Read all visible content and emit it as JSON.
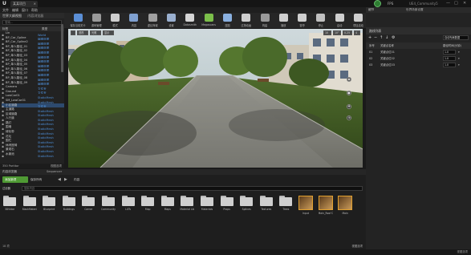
{
  "window": {
    "logo": "U",
    "tab_title": "某某项目",
    "fps_label": "FPS",
    "project_name": "UE4_Community5",
    "controls": [
      "—",
      "□",
      "✕"
    ]
  },
  "menu": [
    "文件",
    "编辑",
    "窗口",
    "帮助"
  ],
  "outliner": {
    "tabs": [
      "世界大纲视图",
      "内容浏览器"
    ],
    "search_placeholder": "搜索...",
    "col_label": "标签",
    "col_type": "类型",
    "rows": [
      {
        "label": "Lin",
        "type": "World",
        "sel": false
      },
      {
        "label": "BP_Car_Spline",
        "type": "编辑蓝图",
        "sel": false
      },
      {
        "label": "BP_Car_Spline2",
        "type": "编辑蓝图",
        "sel": false
      },
      {
        "label": "BP_单人路径_01",
        "type": "编辑蓝图",
        "sel": false
      },
      {
        "label": "BP_单人路径_02",
        "type": "编辑蓝图",
        "sel": false
      },
      {
        "label": "BP_单人路径_03",
        "type": "编辑蓝图",
        "sel": false
      },
      {
        "label": "BP_单人路径_04",
        "type": "编辑蓝图",
        "sel": false
      },
      {
        "label": "BP_单人路径_05",
        "type": "编辑蓝图",
        "sel": false
      },
      {
        "label": "BP_单人路径_06",
        "type": "编辑蓝图",
        "sel": false
      },
      {
        "label": "BP_单人路径_07",
        "type": "编辑蓝图",
        "sel": false
      },
      {
        "label": "BP_单人路径_08",
        "type": "编辑蓝图",
        "sel": false
      },
      {
        "label": "BP_单人路径_09",
        "type": "编辑蓝图",
        "sel": false
      },
      {
        "label": "Camera",
        "type": "文件夹",
        "sel": false
      },
      {
        "label": "Ground",
        "type": "文件夹",
        "sel": false
      },
      {
        "label": "LowCar01",
        "type": "StaticMesh",
        "sel": false
      },
      {
        "label": "SM_LowCar01",
        "type": "StaticMesh",
        "sel": false
      },
      {
        "label": "小区道路",
        "type": "文件夹",
        "sel": true
      },
      {
        "label": "主道路",
        "type": "StaticMesh",
        "sel": false
      },
      {
        "label": "区域道路",
        "type": "StaticMesh",
        "sel": false
      },
      {
        "label": "人行道",
        "type": "StaticMesh",
        "sel": false
      },
      {
        "label": "路灯",
        "type": "StaticMesh",
        "sel": false
      },
      {
        "label": "围墙",
        "type": "StaticMesh",
        "sel": false
      },
      {
        "label": "绿化带",
        "type": "StaticMesh",
        "sel": false
      },
      {
        "label": "花坛",
        "type": "StaticMesh",
        "sel": false
      },
      {
        "label": "围栏",
        "type": "StaticMesh",
        "sel": false
      },
      {
        "label": "休闲座椅",
        "type": "StaticMesh",
        "sel": false
      },
      {
        "label": "景观石",
        "type": "StaticMesh",
        "sel": false
      },
      {
        "label": "水景池",
        "type": "StaticMesh",
        "sel": false
      }
    ],
    "footer": "350 Partitor",
    "view_options": "视图选项"
  },
  "toolbar": {
    "items": [
      {
        "label": "保存当前关卡",
        "icon": "save-icon",
        "color": "#5b8fd6"
      },
      {
        "label": "源码管理",
        "icon": "source-control-icon",
        "color": "#9a9a9a"
      },
      {
        "label": "模式",
        "icon": "modes-icon",
        "color": "#cfcfcf"
      },
      {
        "label": "内容",
        "icon": "content-icon",
        "color": "#7fa0d0"
      },
      {
        "label": "虚幻商城",
        "icon": "marketplace-icon",
        "color": "#a0a0a0"
      },
      {
        "label": "设置",
        "icon": "settings-icon",
        "color": "#9ab0d0"
      },
      {
        "label": "Datasmith",
        "icon": "datasmith-icon",
        "color": "#d6d6d6"
      },
      {
        "label": "Megascans",
        "icon": "megascans-icon",
        "color": "#7bbf4a"
      },
      {
        "label": "蓝图",
        "icon": "blueprint-icon",
        "color": "#8ab0e0"
      },
      {
        "label": "过场动画",
        "icon": "cinematics-icon",
        "color": "#cfcfcf"
      },
      {
        "label": "构建",
        "icon": "build-icon",
        "color": "#9a9a9a"
      },
      {
        "label": "播放",
        "icon": "play-icon",
        "color": "#cfcfcf"
      },
      {
        "label": "暂停",
        "icon": "pause-icon",
        "color": "#cfcfcf"
      },
      {
        "label": "停止",
        "icon": "stop-icon",
        "color": "#c0c0c0"
      },
      {
        "label": "启动",
        "icon": "launch-icon",
        "color": "#cfcfcf"
      },
      {
        "label": "项目启动",
        "icon": "project-launcher-icon",
        "color": "#cfcfcf"
      }
    ]
  },
  "viewport": {
    "view_mode": "透视",
    "lit": "光照",
    "show": "显示",
    "grid_snap": "10",
    "rot_snap": "10°",
    "scale_snap": "0.25",
    "camera_speed": "4"
  },
  "details": {
    "tabs": [
      "细节",
      "世界场景设置"
    ],
    "section_title": "路线列表",
    "dropdown_label": "自动布局数据",
    "col_index": "序号",
    "col_name": "关键点名称",
    "col_dur": "路径时间(分钟)",
    "rows": [
      {
        "index": "01",
        "name": "关键点位01",
        "value": "1.0"
      },
      {
        "index": "02",
        "name": "关键点位02",
        "value": "1.0"
      },
      {
        "index": "03",
        "name": "关键点位03",
        "value": "1.0"
      }
    ]
  },
  "content_browser": {
    "tabs": [
      "内容浏览器",
      "Sequencer"
    ],
    "add_new": "添加新项",
    "save_all": "保存所有",
    "path_root": "内容",
    "filters": "过滤器",
    "search_placeholder": "搜索内容",
    "assets": [
      {
        "label": "3DVidar",
        "kind": "folder"
      },
      {
        "label": "BlackMaterial",
        "kind": "folder"
      },
      {
        "label": "Blueprint",
        "kind": "folder"
      },
      {
        "label": "Buildings",
        "kind": "folder"
      },
      {
        "label": "Camer",
        "kind": "folder"
      },
      {
        "label": "Community",
        "kind": "folder"
      },
      {
        "label": "LUTs",
        "kind": "folder"
      },
      {
        "label": "Map",
        "kind": "folder"
      },
      {
        "label": "Maps",
        "kind": "folder"
      },
      {
        "label": "Material Library",
        "kind": "folder"
      },
      {
        "label": "Materials",
        "kind": "folder"
      },
      {
        "label": "Props",
        "kind": "folder"
      },
      {
        "label": "Splines",
        "kind": "folder"
      },
      {
        "label": "Textures",
        "kind": "folder"
      },
      {
        "label": "Trees",
        "kind": "folder"
      },
      {
        "label": "Input",
        "kind": "texture"
      },
      {
        "label": "Main_Roof Data",
        "kind": "texture"
      },
      {
        "label": "Main",
        "kind": "texture"
      }
    ],
    "item_count": "18 项",
    "view_options": "视图选项"
  },
  "status": {
    "left": "",
    "right": "视图选项"
  },
  "colors": {
    "accent_green": "#4caf50",
    "accent_orange": "#e8a030",
    "selection": "#2d4a6e",
    "type_blue": "#4e8fd8"
  }
}
